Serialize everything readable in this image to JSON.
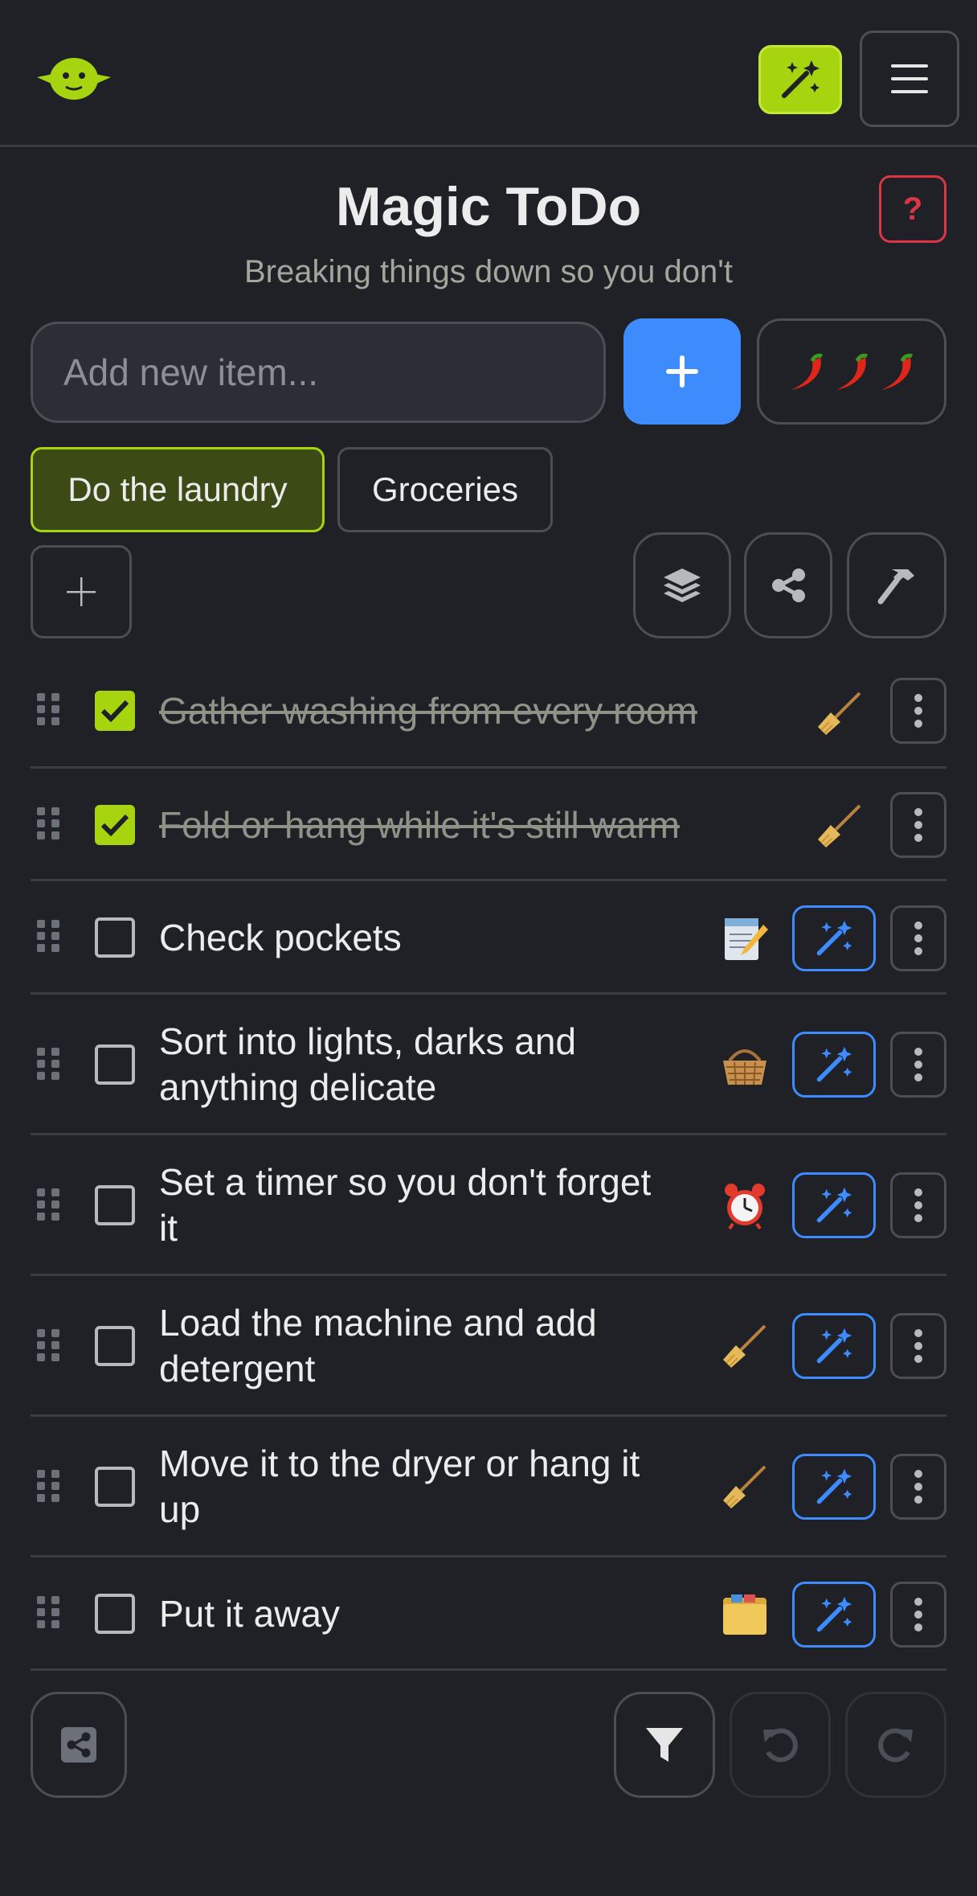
{
  "app": {
    "title": "Magic ToDo",
    "subtitle": "Breaking things down so you don't",
    "help_label": "?"
  },
  "add_item": {
    "placeholder": "Add new item...",
    "spiciness": 3
  },
  "lists": [
    {
      "label": "Do the laundry",
      "active": true
    },
    {
      "label": "Groceries",
      "active": false
    }
  ],
  "items": [
    {
      "text": "Gather washing from every room",
      "done": true,
      "emoji": "broom-icon"
    },
    {
      "text": "Fold or hang while it's still warm",
      "done": true,
      "emoji": "broom-icon"
    },
    {
      "text": "Check pockets",
      "done": false,
      "emoji": "memo-icon"
    },
    {
      "text": "Sort into lights, darks and",
      "text2": "anything delicate",
      "done": false,
      "emoji": "basket-icon"
    },
    {
      "text": "Set a timer so you don't forget",
      "text2": "it",
      "done": false,
      "emoji": "alarm-clock-icon"
    },
    {
      "text": "Load the machine and add",
      "text2": "detergent",
      "done": false,
      "emoji": "broom-icon"
    },
    {
      "text": "Move it to the dryer or hang it",
      "text2": "up",
      "done": false,
      "emoji": "broom-icon"
    },
    {
      "text": "Put it away",
      "done": false,
      "emoji": "card-index-icon"
    }
  ],
  "colors": {
    "accent": "#a6d40f",
    "primary": "#3d8bfd",
    "danger": "#dc3545",
    "background": "#1f2126"
  }
}
